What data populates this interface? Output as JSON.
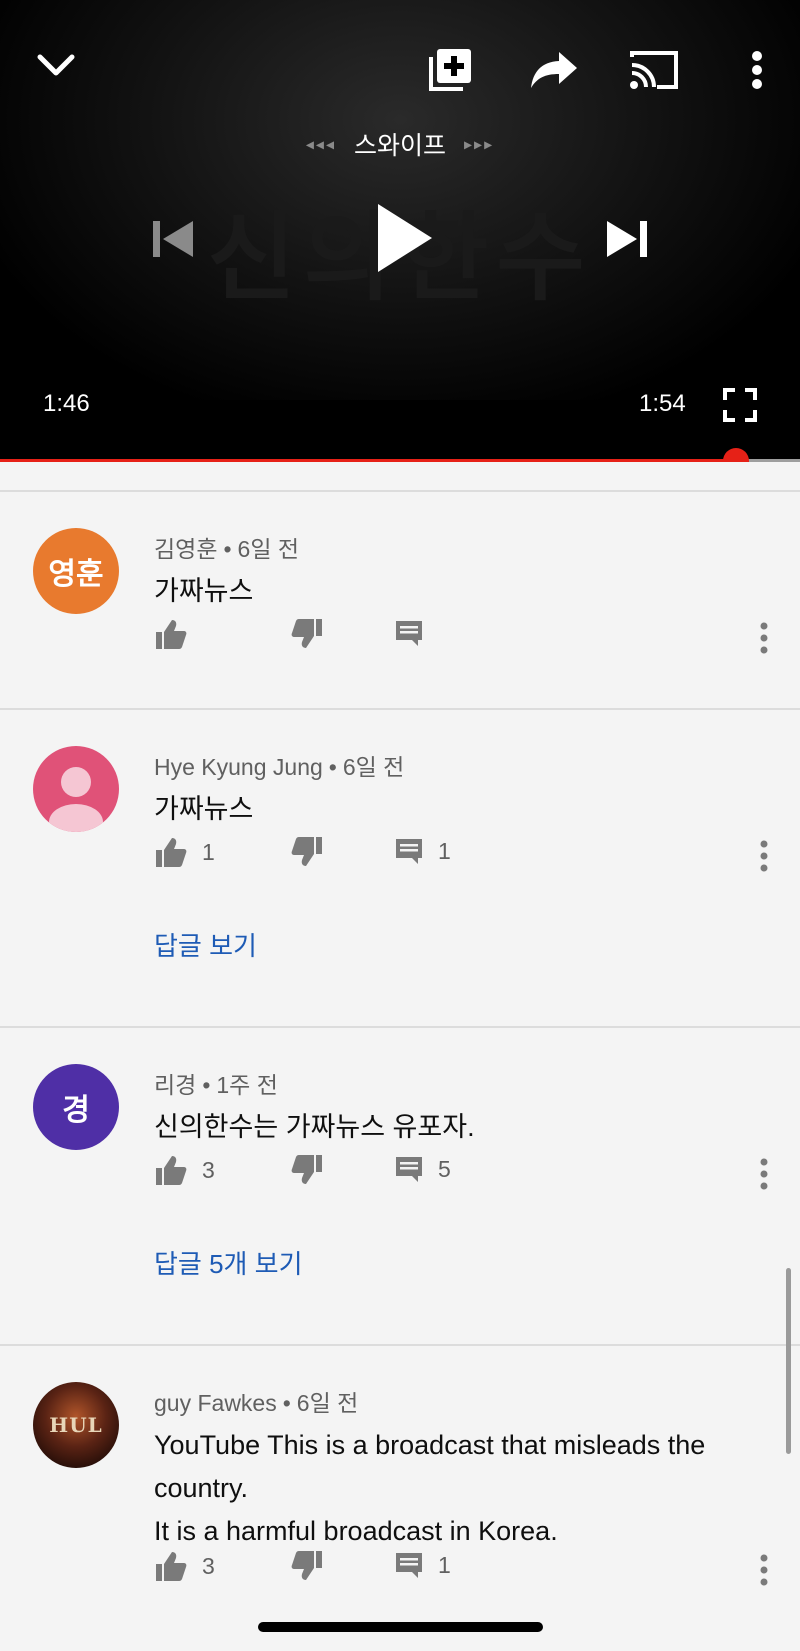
{
  "player": {
    "swipe_label": "스와이프",
    "swipe_left_arrows": "◂◂◂",
    "swipe_right_arrows": "▸▸▸",
    "current_time": "1:46",
    "duration": "1:54",
    "progress_fraction": 0.92,
    "background_title": "신의한수",
    "accent_color": "#e62117"
  },
  "comments": [
    {
      "avatar_text": "영훈",
      "avatar_color": "#e87a2e",
      "author": "김영훈",
      "time": "6일 전",
      "text": [
        "가짜뉴스"
      ],
      "likes": "",
      "replies_count": "",
      "view_replies": ""
    },
    {
      "avatar_text": "",
      "avatar_color": "#e05278",
      "author": "Hye Kyung Jung",
      "time": "6일 전",
      "text": [
        "가짜뉴스"
      ],
      "likes": "1",
      "replies_count": "1",
      "view_replies": "답글 보기"
    },
    {
      "avatar_text": "경",
      "avatar_color": "#4f2fa6",
      "author": "리경",
      "time": "1주 전",
      "text": [
        "신의한수는 가짜뉴스 유포자."
      ],
      "likes": "3",
      "replies_count": "5",
      "view_replies": "답글 5개 보기"
    },
    {
      "avatar_text": "HUL",
      "avatar_color": "#3a1a12",
      "author": "guy Fawkes",
      "time": "6일 전",
      "text": [
        "YouTube This is a broadcast that misleads the",
        "country.",
        "It is a harmful broadcast in Korea."
      ],
      "likes": "3",
      "replies_count": "1",
      "view_replies": ""
    }
  ],
  "meta_separator": "•",
  "icons": {
    "collapse": "chevron-down-icon",
    "add_to_playlist": "playlist-add-icon",
    "share": "share-icon",
    "cast": "cast-icon",
    "more": "more-vert-icon",
    "previous": "skip-previous-icon",
    "play": "play-icon",
    "next": "skip-next-icon",
    "fullscreen": "fullscreen-icon",
    "like": "thumb-up-icon",
    "dislike": "thumb-down-icon",
    "reply": "comment-icon"
  }
}
